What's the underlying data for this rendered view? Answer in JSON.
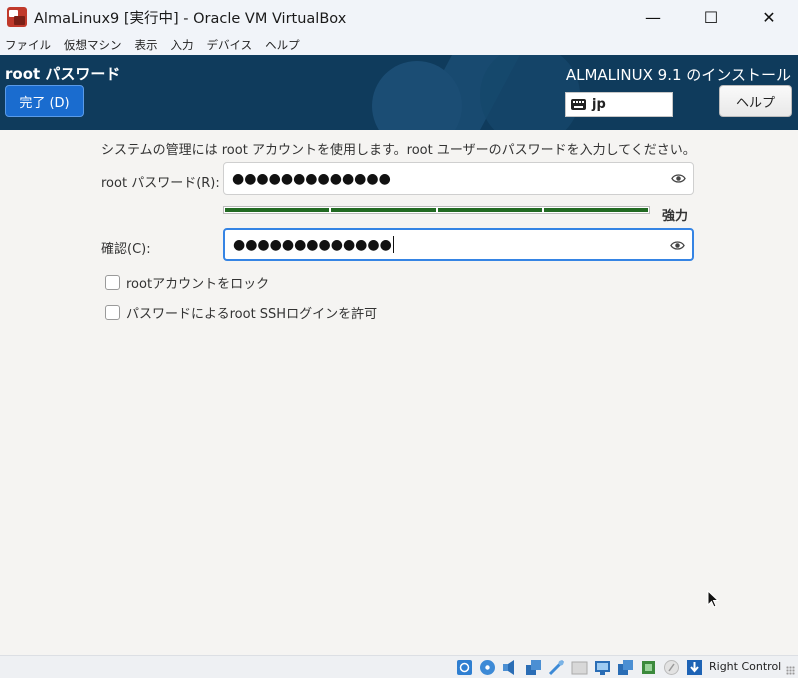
{
  "window": {
    "title": "AlmaLinux9 [実行中] - Oracle VM VirtualBox",
    "minimize_glyph": "—",
    "maximize_glyph": "☐",
    "close_glyph": "✕"
  },
  "menu": {
    "items": [
      "ファイル",
      "仮想マシン",
      "表示",
      "入力",
      "デバイス",
      "ヘルプ"
    ]
  },
  "header": {
    "spoke_title": "root パスワード",
    "done_label": "完了 (D)",
    "install_title": "ALMALINUX 9.1 のインストール",
    "keyboard_layout": "jp",
    "help_label": "ヘルプ"
  },
  "form": {
    "description": "システムの管理には root アカウントを使用します。root ユーザーのパスワードを入力してください。",
    "password_label": "root パスワード(R):",
    "password_value": "●●●●●●●●●●●●●",
    "strength_label": "強力",
    "strength_level": 1.0,
    "confirm_label": "確認(C):",
    "confirm_value": "●●●●●●●●●●●●●",
    "lock_root_label": "rootアカウントをロック",
    "lock_root_checked": false,
    "allow_ssh_label": "パスワードによるroot SSHログインを許可",
    "allow_ssh_checked": false
  },
  "statusbar": {
    "host_key_label": "Right Control",
    "icons": [
      "hard-disk-icon",
      "optical-disk-icon",
      "audio-icon",
      "network-icon",
      "usb-icon",
      "shared-folder-icon",
      "display-icon",
      "recording-icon",
      "cpu-icon",
      "mouse-integration-icon",
      "keyboard-capture-icon"
    ]
  },
  "colors": {
    "header_bg": "#0f3b5c",
    "done_button": "#1a6ccf",
    "strength_bar": "#226a22",
    "focus_border": "#3584e4"
  }
}
